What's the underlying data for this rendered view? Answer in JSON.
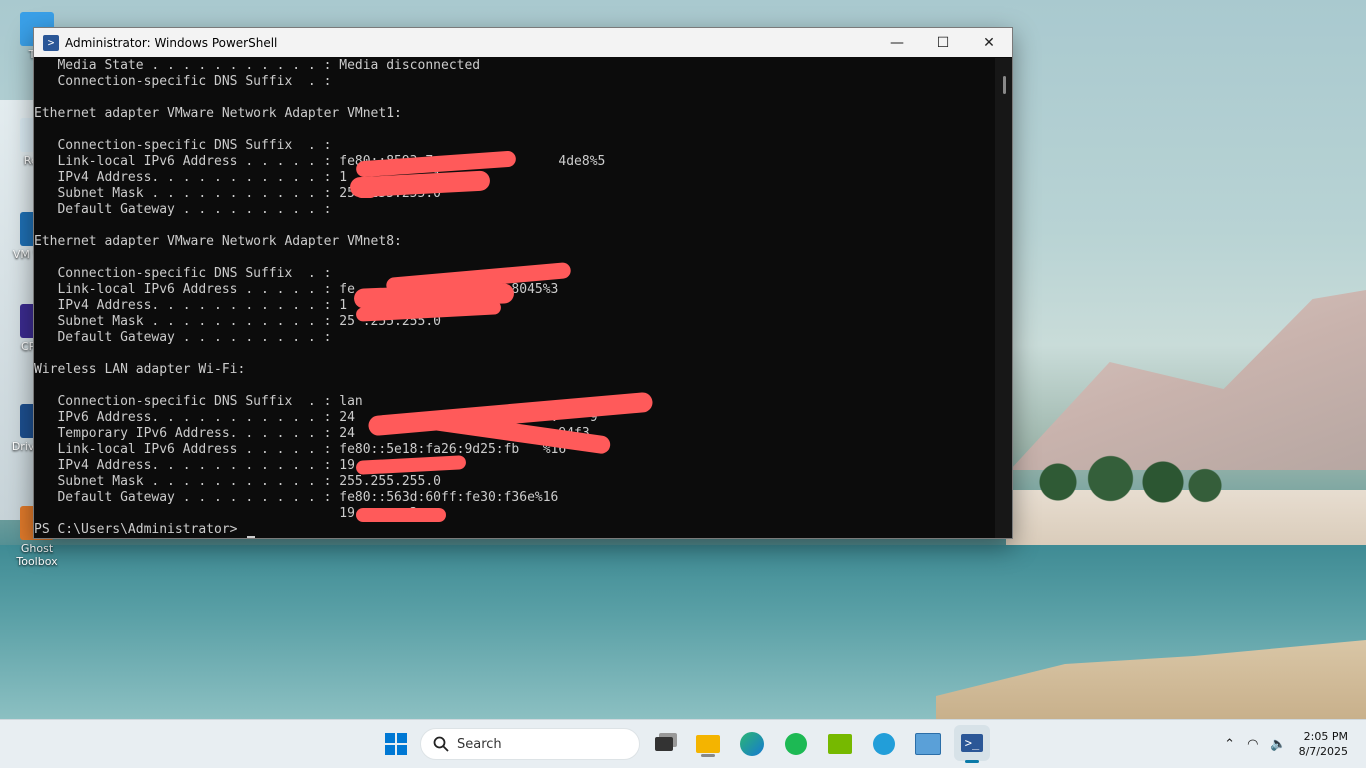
{
  "window": {
    "title": "Administrator: Windows PowerShell",
    "minimize": "—",
    "maximize": "☐",
    "close": "✕"
  },
  "console": {
    "lines": [
      "   Media State . . . . . . . . . . . : Media disconnected",
      "   Connection-specific DNS Suffix  . :",
      "",
      "Ethernet adapter VMware Network Adapter VMnet1:",
      "",
      "   Connection-specific DNS Suffix  . :",
      "   Link-local IPv6 Address . . . . . : fe80::8593:7c               4de8%5",
      "   IPv4 Address. . . . . . . . . . . : 1          .1",
      "   Subnet Mask . . . . . . . . . . . : 25 .255.255.0",
      "   Default Gateway . . . . . . . . . :",
      "",
      "Ethernet adapter VMware Network Adapter VMnet8:",
      "",
      "   Connection-specific DNS Suffix  . :",
      "   Link-local IPv6 Address . . . . . : fe     2ef:ac        :8045%3",
      "   IPv4 Address. . . . . . . . . . . : 1",
      "   Subnet Mask . . . . . . . . . . . : 25 .255.255.0",
      "   Default Gateway . . . . . . . . . :",
      "",
      "Wireless LAN adapter Wi-Fi:",
      "",
      "   Connection-specific DNS Suffix  . : lan",
      "   IPv6 Address. . . . . . . . . . . : 24            f738:c7d7:   :    9",
      "   Temporary IPv6 Address. . . . . . : 24                         :94f3",
      "   Link-local IPv6 Address . . . . . : fe80::5e18:fa26:9d25:fb   %16",
      "   IPv4 Address. . . . . . . . . . . : 19",
      "   Subnet Mask . . . . . . . . . . . : 255.255.255.0",
      "   Default Gateway . . . . . . . . . : fe80::563d:60ff:fe30:f36e%16",
      "                                       19       3",
      "PS C:\\Users\\Administrator> "
    ]
  },
  "desktop_icons": [
    {
      "label": "Thi",
      "color": "#3aa0e8"
    },
    {
      "label": "Recy",
      "color": "#d8e8f0"
    },
    {
      "label": "VM Work",
      "color": "#1f6fb3"
    },
    {
      "label": "CP CP",
      "color": "#3b2b8f"
    },
    {
      "label": "Drive Por",
      "color": "#1d4f8f"
    },
    {
      "label": "Ghost Toolbox",
      "color": "#e07a2b"
    }
  ],
  "taskbar": {
    "search_placeholder": "Search",
    "time": "2:05 PM",
    "date": "8/7/2025"
  },
  "colors": {
    "console_bg": "#0c0c0c",
    "console_text": "#cccccc",
    "redaction": "#ff5a5a"
  }
}
